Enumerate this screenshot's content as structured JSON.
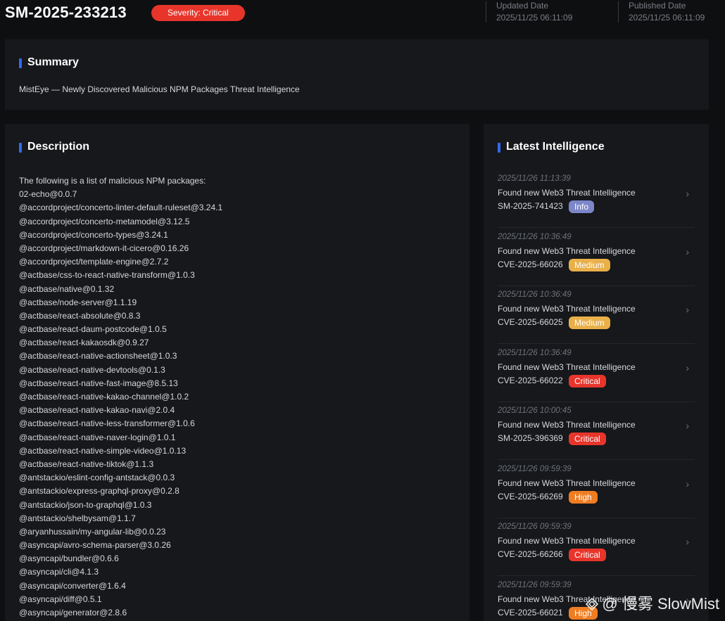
{
  "header": {
    "threat_id": "SM-2025-233213",
    "severity_badge": "Severity: Critical",
    "updated": {
      "label": "Updated Date",
      "value": "2025/11/25 06:11:09"
    },
    "published": {
      "label": "Published Date",
      "value": "2025/11/25 06:11:09"
    }
  },
  "summary": {
    "title": "Summary",
    "text": "MistEye — Newly Discovered Malicious NPM Packages Threat Intelligence"
  },
  "description": {
    "title": "Description",
    "lines": [
      "The following is a list of malicious NPM packages:",
      "02-echo@0.0.7",
      "@accordproject/concerto-linter-default-ruleset@3.24.1",
      "@accordproject/concerto-metamodel@3.12.5",
      "@accordproject/concerto-types@3.24.1",
      "@accordproject/markdown-it-cicero@0.16.26",
      "@accordproject/template-engine@2.7.2",
      "@actbase/css-to-react-native-transform@1.0.3",
      "@actbase/native@0.1.32",
      "@actbase/node-server@1.1.19",
      "@actbase/react-absolute@0.8.3",
      "@actbase/react-daum-postcode@1.0.5",
      "@actbase/react-kakaosdk@0.9.27",
      "@actbase/react-native-actionsheet@1.0.3",
      "@actbase/react-native-devtools@0.1.3",
      "@actbase/react-native-fast-image@8.5.13",
      "@actbase/react-native-kakao-channel@1.0.2",
      "@actbase/react-native-kakao-navi@2.0.4",
      "@actbase/react-native-less-transformer@1.0.6",
      "@actbase/react-native-naver-login@1.0.1",
      "@actbase/react-native-simple-video@1.0.13",
      "@actbase/react-native-tiktok@1.1.3",
      "@antstackio/eslint-config-antstack@0.0.3",
      "@antstackio/express-graphql-proxy@0.2.8",
      "@antstackio/json-to-graphql@1.0.3",
      "@antstackio/shelbysam@1.1.7",
      "@aryanhussain/my-angular-lib@0.0.23",
      "@asyncapi/avro-schema-parser@3.0.26",
      "@asyncapi/bundler@0.6.6",
      "@asyncapi/cli@4.1.3",
      "@asyncapi/converter@1.6.4",
      "@asyncapi/diff@0.5.1",
      "@asyncapi/generator@2.8.6"
    ]
  },
  "latest": {
    "title": "Latest Intelligence",
    "chevron": "›",
    "items": [
      {
        "time": "2025/11/26 11:13:39",
        "title": "Found new Web3 Threat Intelligence",
        "id": "SM-2025-741423",
        "badge": "Info"
      },
      {
        "time": "2025/11/26 10:36:49",
        "title": "Found new Web3 Threat Intelligence",
        "id": "CVE-2025-66026",
        "badge": "Medium"
      },
      {
        "time": "2025/11/26 10:36:49",
        "title": "Found new Web3 Threat Intelligence",
        "id": "CVE-2025-66025",
        "badge": "Medium"
      },
      {
        "time": "2025/11/26 10:36:49",
        "title": "Found new Web3 Threat Intelligence",
        "id": "CVE-2025-66022",
        "badge": "Critical"
      },
      {
        "time": "2025/11/26 10:00:45",
        "title": "Found new Web3 Threat Intelligence",
        "id": "SM-2025-396369",
        "badge": "Critical"
      },
      {
        "time": "2025/11/26 09:59:39",
        "title": "Found new Web3 Threat Intelligence",
        "id": "CVE-2025-66269",
        "badge": "High"
      },
      {
        "time": "2025/11/26 09:59:39",
        "title": "Found new Web3 Threat Intelligence",
        "id": "CVE-2025-66266",
        "badge": "Critical"
      },
      {
        "time": "2025/11/26 09:59:39",
        "title": "Found new Web3 Threat Intelligence",
        "id": "CVE-2025-66021",
        "badge": "High"
      }
    ],
    "badge_colors": {
      "Info": "#7c86c9",
      "Medium": "#e9b04a",
      "Critical": "#e8352b",
      "High": "#ef7d22"
    }
  },
  "colors": {
    "accent": "#2f6bf0",
    "critical": "#e8352b"
  },
  "watermark": {
    "text": "@ 慢雾 SlowMist",
    "icon": "slowmist-logo-icon"
  }
}
